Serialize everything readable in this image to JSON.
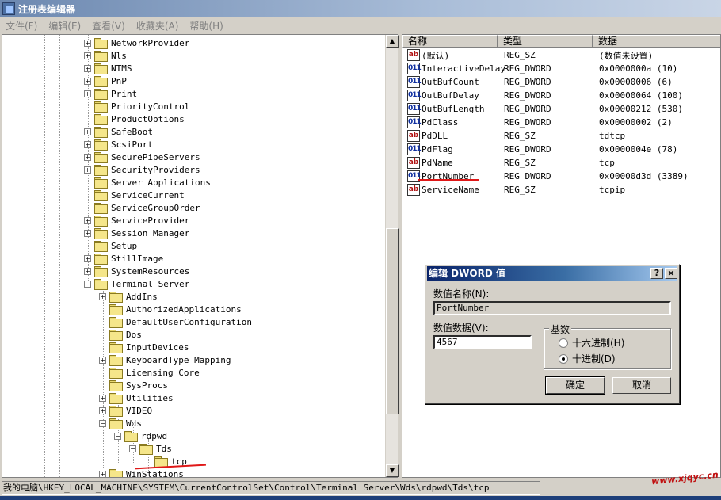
{
  "window": {
    "title": "注册表编辑器"
  },
  "menu": [
    "文件(F)",
    "编辑(E)",
    "查看(V)",
    "收藏夹(A)",
    "帮助(H)"
  ],
  "tree": [
    {
      "label": "NetworkProvider",
      "indent": 0,
      "exp": true
    },
    {
      "label": "Nls",
      "indent": 0,
      "exp": true
    },
    {
      "label": "NTMS",
      "indent": 0,
      "exp": true
    },
    {
      "label": "PnP",
      "indent": 0,
      "exp": true
    },
    {
      "label": "Print",
      "indent": 0,
      "exp": true
    },
    {
      "label": "PriorityControl",
      "indent": 0,
      "exp": false
    },
    {
      "label": "ProductOptions",
      "indent": 0,
      "exp": false
    },
    {
      "label": "SafeBoot",
      "indent": 0,
      "exp": true
    },
    {
      "label": "ScsiPort",
      "indent": 0,
      "exp": true
    },
    {
      "label": "SecurePipeServers",
      "indent": 0,
      "exp": true
    },
    {
      "label": "SecurityProviders",
      "indent": 0,
      "exp": true
    },
    {
      "label": "Server Applications",
      "indent": 0,
      "exp": false
    },
    {
      "label": "ServiceCurrent",
      "indent": 0,
      "exp": false
    },
    {
      "label": "ServiceGroupOrder",
      "indent": 0,
      "exp": false
    },
    {
      "label": "ServiceProvider",
      "indent": 0,
      "exp": true
    },
    {
      "label": "Session Manager",
      "indent": 0,
      "exp": true
    },
    {
      "label": "Setup",
      "indent": 0,
      "exp": false
    },
    {
      "label": "StillImage",
      "indent": 0,
      "exp": true
    },
    {
      "label": "SystemResources",
      "indent": 0,
      "exp": true
    },
    {
      "label": "Terminal Server",
      "indent": 0,
      "exp": "minus"
    },
    {
      "label": "AddIns",
      "indent": 1,
      "exp": true
    },
    {
      "label": "AuthorizedApplications",
      "indent": 1,
      "exp": false
    },
    {
      "label": "DefaultUserConfiguration",
      "indent": 1,
      "exp": false
    },
    {
      "label": "Dos",
      "indent": 1,
      "exp": false
    },
    {
      "label": "InputDevices",
      "indent": 1,
      "exp": false
    },
    {
      "label": "KeyboardType Mapping",
      "indent": 1,
      "exp": true
    },
    {
      "label": "Licensing Core",
      "indent": 1,
      "exp": false
    },
    {
      "label": "SysProcs",
      "indent": 1,
      "exp": false
    },
    {
      "label": "Utilities",
      "indent": 1,
      "exp": true
    },
    {
      "label": "VIDEO",
      "indent": 1,
      "exp": true
    },
    {
      "label": "Wds",
      "indent": 1,
      "exp": "minus"
    },
    {
      "label": "rdpwd",
      "indent": 2,
      "exp": "minus"
    },
    {
      "label": "Tds",
      "indent": 3,
      "exp": "minus"
    },
    {
      "label": "tcp",
      "indent": 4,
      "exp": false
    },
    {
      "label": "WinStations",
      "indent": 1,
      "exp": true
    }
  ],
  "list": {
    "headers": [
      "名称",
      "类型",
      "数据"
    ],
    "rows": [
      {
        "name": "(默认)",
        "type": "REG_SZ",
        "data": "(数值未设置)",
        "icon": "string-value-icon"
      },
      {
        "name": "InteractiveDelay",
        "type": "REG_DWORD",
        "data": "0x0000000a (10)",
        "icon": "binary-value-icon"
      },
      {
        "name": "OutBufCount",
        "type": "REG_DWORD",
        "data": "0x00000006 (6)",
        "icon": "binary-value-icon"
      },
      {
        "name": "OutBufDelay",
        "type": "REG_DWORD",
        "data": "0x00000064 (100)",
        "icon": "binary-value-icon"
      },
      {
        "name": "OutBufLength",
        "type": "REG_DWORD",
        "data": "0x00000212 (530)",
        "icon": "binary-value-icon"
      },
      {
        "name": "PdClass",
        "type": "REG_DWORD",
        "data": "0x00000002 (2)",
        "icon": "binary-value-icon"
      },
      {
        "name": "PdDLL",
        "type": "REG_SZ",
        "data": "tdtcp",
        "icon": "string-value-icon"
      },
      {
        "name": "PdFlag",
        "type": "REG_DWORD",
        "data": "0x0000004e (78)",
        "icon": "binary-value-icon"
      },
      {
        "name": "PdName",
        "type": "REG_SZ",
        "data": "tcp",
        "icon": "string-value-icon"
      },
      {
        "name": "PortNumber",
        "type": "REG_DWORD",
        "data": "0x00000d3d (3389)",
        "icon": "binary-value-icon"
      },
      {
        "name": "ServiceName",
        "type": "REG_SZ",
        "data": "tcpip",
        "icon": "string-value-icon"
      }
    ]
  },
  "dialog": {
    "title": "编辑 DWORD 值",
    "help_btn": "?",
    "close_btn": "×",
    "name_label": "数值名称(N):",
    "name_value": "PortNumber",
    "data_label": "数值数据(V):",
    "data_value": "4567",
    "base_label": "基数",
    "radio_hex": "十六进制(H)",
    "radio_dec": "十进制(D)",
    "selected": "dec",
    "ok": "确定",
    "cancel": "取消"
  },
  "status": "我的电脑\\HKEY_LOCAL_MACHINE\\SYSTEM\\CurrentControlSet\\Control\\Terminal Server\\Wds\\rdpwd\\Tds\\tcp",
  "watermark": "www.xjqyc.cn",
  "accent": {
    "title": "#0a246a",
    "underline": "#e01818"
  }
}
